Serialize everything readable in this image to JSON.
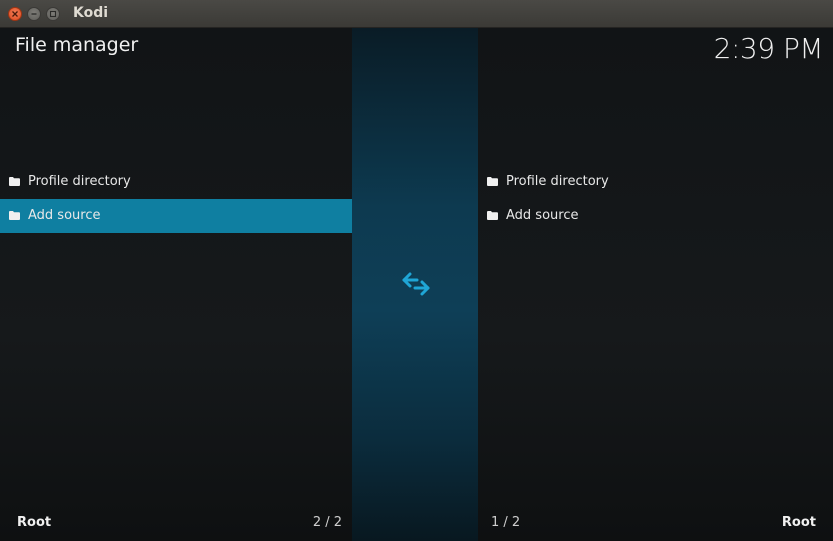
{
  "window": {
    "title": "Kodi"
  },
  "header": {
    "title": "File manager",
    "clock": "2:39 PM"
  },
  "left_pane": {
    "items": [
      {
        "label": "Profile directory",
        "icon": "folder-icon",
        "selected": false
      },
      {
        "label": "Add source",
        "icon": "folder-icon",
        "selected": true
      }
    ],
    "path": "Root",
    "page": "2 / 2"
  },
  "right_pane": {
    "items": [
      {
        "label": "Profile directory",
        "icon": "folder-icon",
        "selected": false
      },
      {
        "label": "Add source",
        "icon": "folder-icon",
        "selected": false
      }
    ],
    "path": "Root",
    "page": "1 / 2"
  },
  "center": {
    "icon": "swap-arrows-icon"
  },
  "colors": {
    "accent": "#0f7fa1",
    "swap_icon": "#1fa6d6",
    "close_button": "#e35a2e"
  }
}
